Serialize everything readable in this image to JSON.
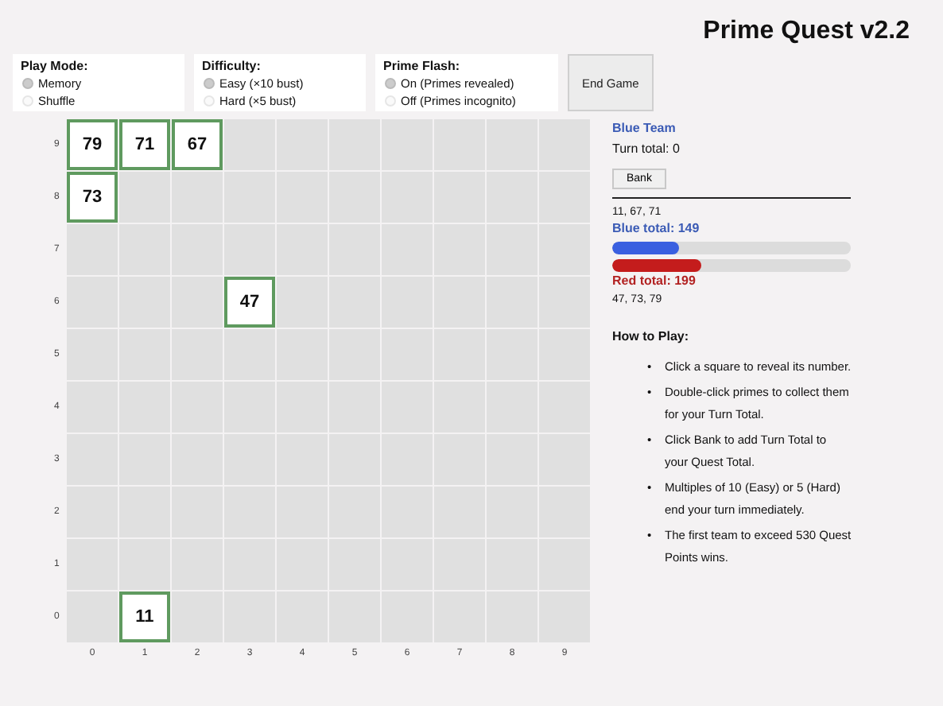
{
  "title": "Prime Quest v2.2",
  "controls": [
    {
      "label": "Play Mode:",
      "options": [
        {
          "label": "Memory",
          "selected": true
        },
        {
          "label": "Shuffle",
          "selected": false
        }
      ]
    },
    {
      "label": "Difficulty:",
      "options": [
        {
          "label": "Easy (×10 bust)",
          "selected": true
        },
        {
          "label": "Hard (×5 bust)",
          "selected": false
        }
      ]
    },
    {
      "label": "Prime Flash:",
      "options": [
        {
          "label": "On (Primes revealed)",
          "selected": true
        },
        {
          "label": "Off (Primes incognito)",
          "selected": false
        }
      ]
    }
  ],
  "end_button": "End Game",
  "grid": {
    "rows": [
      {
        "label": "9",
        "cells": [
          {
            "revealed": true,
            "value": "79"
          },
          {
            "revealed": true,
            "value": "71"
          },
          {
            "revealed": true,
            "value": "67"
          },
          {
            "revealed": false
          },
          {
            "revealed": false
          },
          {
            "revealed": false
          },
          {
            "revealed": false
          },
          {
            "revealed": false
          },
          {
            "revealed": false
          },
          {
            "revealed": false
          }
        ]
      },
      {
        "label": "8",
        "cells": [
          {
            "revealed": true,
            "value": "73"
          },
          {
            "revealed": false
          },
          {
            "revealed": false
          },
          {
            "revealed": false
          },
          {
            "revealed": false
          },
          {
            "revealed": false
          },
          {
            "revealed": false
          },
          {
            "revealed": false
          },
          {
            "revealed": false
          },
          {
            "revealed": false
          }
        ]
      },
      {
        "label": "7",
        "cells": [
          {
            "revealed": false
          },
          {
            "revealed": false
          },
          {
            "revealed": false
          },
          {
            "revealed": false
          },
          {
            "revealed": false
          },
          {
            "revealed": false
          },
          {
            "revealed": false
          },
          {
            "revealed": false
          },
          {
            "revealed": false
          },
          {
            "revealed": false
          }
        ]
      },
      {
        "label": "6",
        "cells": [
          {
            "revealed": false
          },
          {
            "revealed": false
          },
          {
            "revealed": false
          },
          {
            "revealed": true,
            "value": "47"
          },
          {
            "revealed": false
          },
          {
            "revealed": false
          },
          {
            "revealed": false
          },
          {
            "revealed": false
          },
          {
            "revealed": false
          },
          {
            "revealed": false
          }
        ]
      },
      {
        "label": "5",
        "cells": [
          {
            "revealed": false
          },
          {
            "revealed": false
          },
          {
            "revealed": false
          },
          {
            "revealed": false
          },
          {
            "revealed": false
          },
          {
            "revealed": false
          },
          {
            "revealed": false
          },
          {
            "revealed": false
          },
          {
            "revealed": false
          },
          {
            "revealed": false
          }
        ]
      },
      {
        "label": "4",
        "cells": [
          {
            "revealed": false
          },
          {
            "revealed": false
          },
          {
            "revealed": false
          },
          {
            "revealed": false
          },
          {
            "revealed": false
          },
          {
            "revealed": false
          },
          {
            "revealed": false
          },
          {
            "revealed": false
          },
          {
            "revealed": false
          },
          {
            "revealed": false
          }
        ]
      },
      {
        "label": "3",
        "cells": [
          {
            "revealed": false
          },
          {
            "revealed": false
          },
          {
            "revealed": false
          },
          {
            "revealed": false
          },
          {
            "revealed": false
          },
          {
            "revealed": false
          },
          {
            "revealed": false
          },
          {
            "revealed": false
          },
          {
            "revealed": false
          },
          {
            "revealed": false
          }
        ]
      },
      {
        "label": "2",
        "cells": [
          {
            "revealed": false
          },
          {
            "revealed": false
          },
          {
            "revealed": false
          },
          {
            "revealed": false
          },
          {
            "revealed": false
          },
          {
            "revealed": false
          },
          {
            "revealed": false
          },
          {
            "revealed": false
          },
          {
            "revealed": false
          },
          {
            "revealed": false
          }
        ]
      },
      {
        "label": "1",
        "cells": [
          {
            "revealed": false
          },
          {
            "revealed": false
          },
          {
            "revealed": false
          },
          {
            "revealed": false
          },
          {
            "revealed": false
          },
          {
            "revealed": false
          },
          {
            "revealed": false
          },
          {
            "revealed": false
          },
          {
            "revealed": false
          },
          {
            "revealed": false
          }
        ]
      },
      {
        "label": "0",
        "cells": [
          {
            "revealed": false
          },
          {
            "revealed": true,
            "value": "11"
          },
          {
            "revealed": false
          },
          {
            "revealed": false
          },
          {
            "revealed": false
          },
          {
            "revealed": false
          },
          {
            "revealed": false
          },
          {
            "revealed": false
          },
          {
            "revealed": false
          },
          {
            "revealed": false
          }
        ]
      }
    ],
    "column_labels": [
      "0",
      "1",
      "2",
      "3",
      "4",
      "5",
      "6",
      "7",
      "8",
      "9"
    ]
  },
  "current_team": "Blue Team",
  "turn_total": "Turn total: 0",
  "bank_button": "Bank",
  "blue_primes": "11, 67, 71",
  "blue_total": "Blue total: 149",
  "blue_bar": {
    "level": 0.28
  },
  "red_bar": {
    "level": 0.375
  },
  "red_total": "Red total: 199",
  "red_primes": "47, 73, 79",
  "help": {
    "title": "How to Play:",
    "items": [
      {
        "marker": "•",
        "text": "Click a square to reveal its number."
      },
      {
        "marker": "•",
        "text": "Double-click primes to collect them for your Turn Total."
      },
      {
        "marker": "•",
        "text": "Click Bank to add Turn Total to your Quest Total."
      },
      {
        "marker": "•",
        "text": "Multiples of 10 (Easy) or 5 (Hard) end your turn immediately."
      },
      {
        "marker": "•",
        "text": "The first team to exceed 530 Quest Points wins."
      }
    ]
  }
}
